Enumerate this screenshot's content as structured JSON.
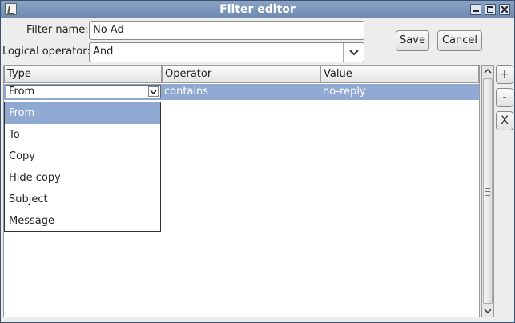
{
  "window": {
    "title": "Filter editor"
  },
  "form": {
    "filter_name_label": "Filter name:",
    "filter_name_value": "No Ad",
    "logical_operator_label": "Logical operator:",
    "logical_operator_value": "And"
  },
  "buttons": {
    "save": "Save",
    "cancel": "Cancel"
  },
  "table": {
    "columns": [
      "Type",
      "Operator",
      "Value"
    ],
    "rows": [
      {
        "type": "From",
        "operator": "contains",
        "value": "no-reply"
      }
    ]
  },
  "type_dropdown": {
    "selected": "From",
    "options": [
      "From",
      "To",
      "Copy",
      "Hide copy",
      "Subject",
      "Message"
    ]
  },
  "side_buttons": {
    "add": "+",
    "remove": "-",
    "clear": "X"
  }
}
